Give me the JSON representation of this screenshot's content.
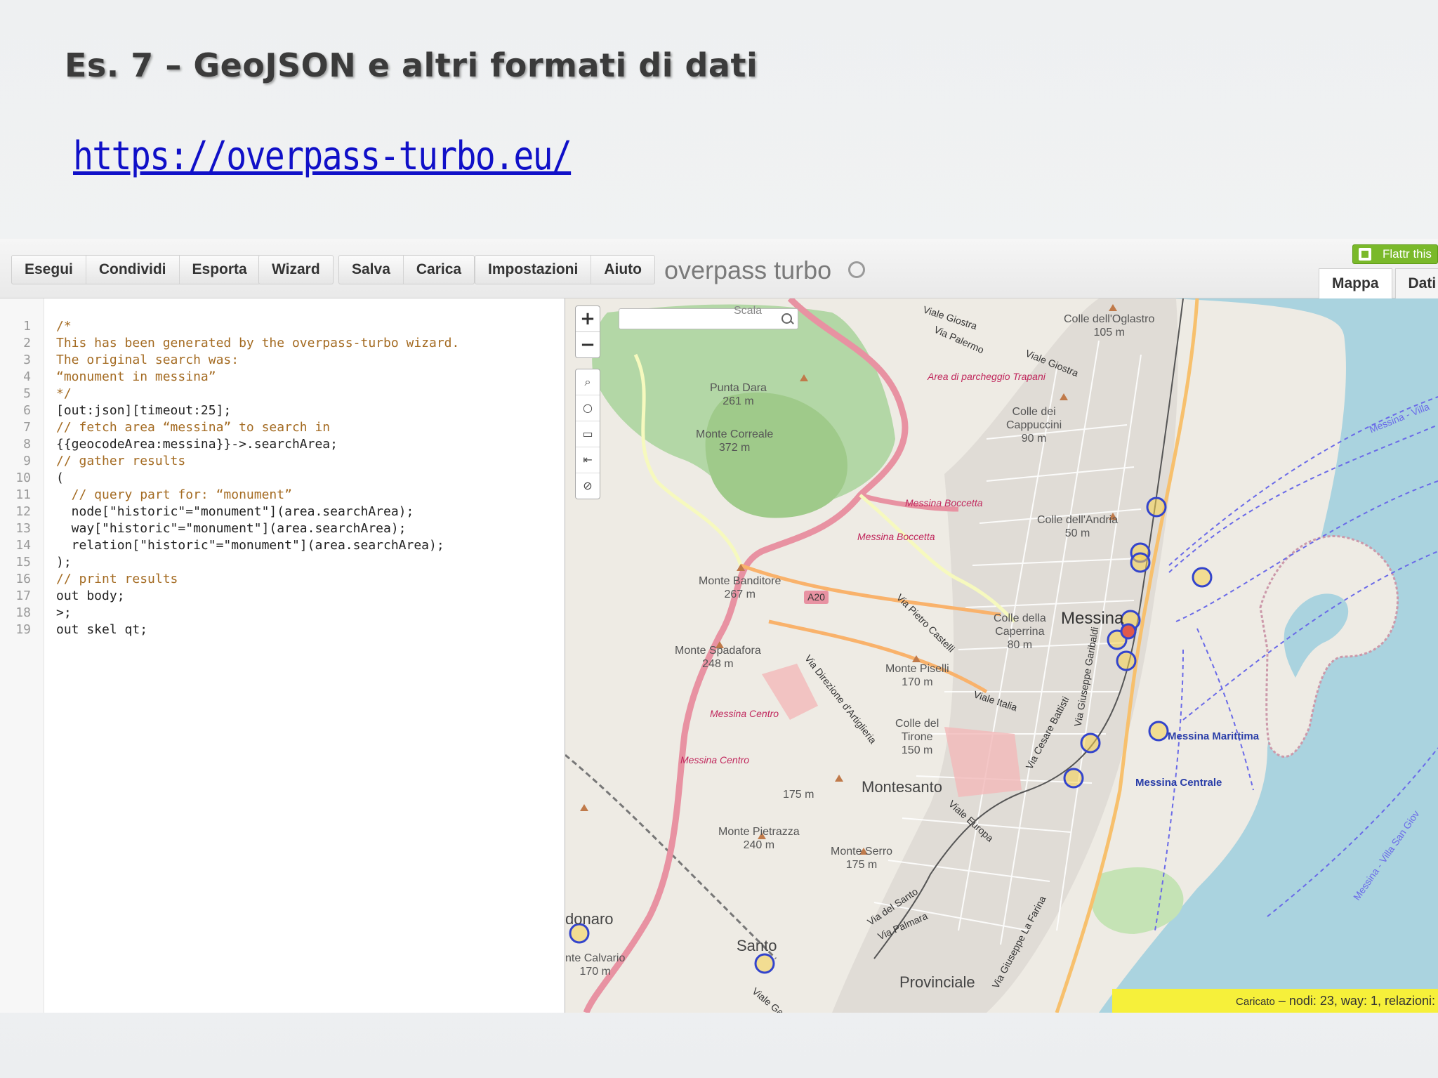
{
  "slide": {
    "title": "Es. 7 – GeoJSON e altri formati di dati",
    "link": "https://overpass-turbo.eu/"
  },
  "toolbar": {
    "groups": [
      [
        "Esegui",
        "Condividi",
        "Esporta"
      ],
      [
        "Wizard"
      ],
      [
        "Salva",
        "Carica"
      ],
      [
        "Impostazioni",
        "Aiuto"
      ]
    ],
    "brand": "overpass turbo",
    "flattr": "Flattr this",
    "tabs": [
      "Mappa",
      "Dati"
    ]
  },
  "editor": {
    "lines": [
      "/*",
      "This has been generated by the overpass-turbo wizard.",
      "The original search was:",
      "“monument in messina”",
      "*/",
      "[out:json][timeout:25];",
      "// fetch area “messina” to search in",
      "{{geocodeArea:messina}}->.searchArea;",
      "// gather results",
      "(",
      "  // query part for: “monument”",
      "  node[\"historic\"=\"monument\"](area.searchArea);",
      "  way[\"historic\"=\"monument\"](area.searchArea);",
      "  relation[\"historic\"=\"monument\"](area.searchArea);",
      ");",
      "// print results",
      "out body;",
      ">;",
      "out skel qt;"
    ],
    "line_numbers": [
      "1",
      "2",
      "3",
      "4",
      "5",
      "6",
      "7",
      "8",
      "9",
      "10",
      "11",
      "12",
      "13",
      "14",
      "15",
      "16",
      "17",
      "18",
      "19"
    ]
  },
  "map": {
    "zoom_in": "+",
    "zoom_out": "−",
    "labels": {
      "punta_dara": "Punta Dara\n261 m",
      "monte_correale": "Monte Correale\n372 m",
      "monte_banditore": "Monte Banditore\n267 m",
      "monte_spadafora": "Monte Spadafora\n248 m",
      "monte_piselli": "Monte Piselli\n170 m",
      "colle_oglastro": "Colle dell'Oglastro\n105 m",
      "colle_cappuccini": "Colle dei\nCappuccini\n90 m",
      "colle_andria": "Colle dell'Andria\n50 m",
      "colle_caperrina": "Colle della\nCaperrina\n80 m",
      "colle_tirone": "Colle del\nTirone\n150 m",
      "m175": "175 m",
      "monte_pietrazza": "Monte Pietrazza\n240 m",
      "monte_serro": "Monte Serro\n175 m",
      "monte_calvario": "nte Calvario\n170 m",
      "messina": "Messina",
      "montesanto": "Montesanto",
      "santo": "Santo",
      "provinciale": "Provinciale",
      "donaro": "donaro",
      "a20": "A20",
      "scala": "Scala",
      "area_parcheggio": "Area di parcheggio Trapani",
      "messina_boccetta_1": "Messina Boccetta",
      "messina_boccetta_2": "Messina Boccetta",
      "messina_centro_1": "Messina Centro",
      "messina_centro_2": "Messina Centro",
      "messina_marittima": "Messina Marittima",
      "messina_centrale": "Messina Centrale",
      "viale_giostra_1": "Viale Giostra",
      "viale_giostra_2": "Viale Giostra",
      "via_palermo": "Via Palermo",
      "via_pietro_castelli": "Via Pietro Castelli",
      "via_direzione": "Via Direzione d'Artiglieria",
      "viale_italia": "Viale Italia",
      "viale_europa": "Viale Europa",
      "via_cesare_battisti": "Via Cesare Battisti",
      "via_giuseppe_garibaldi": "Via Giuseppe Garibaldi",
      "via_del_santo": "Via del Santo",
      "via_palmara": "Via Palmara",
      "via_giuseppe_la_farina": "Via Giuseppe La Farina",
      "viale_gazzi": "Viale Gazzi",
      "ferry_1": "Messina - Villa",
      "ferry_2": "Messina - Villa San Giov"
    },
    "status_prefix": "Caricato",
    "status_text": " – nodi: 23, way: 1, relazioni:"
  }
}
